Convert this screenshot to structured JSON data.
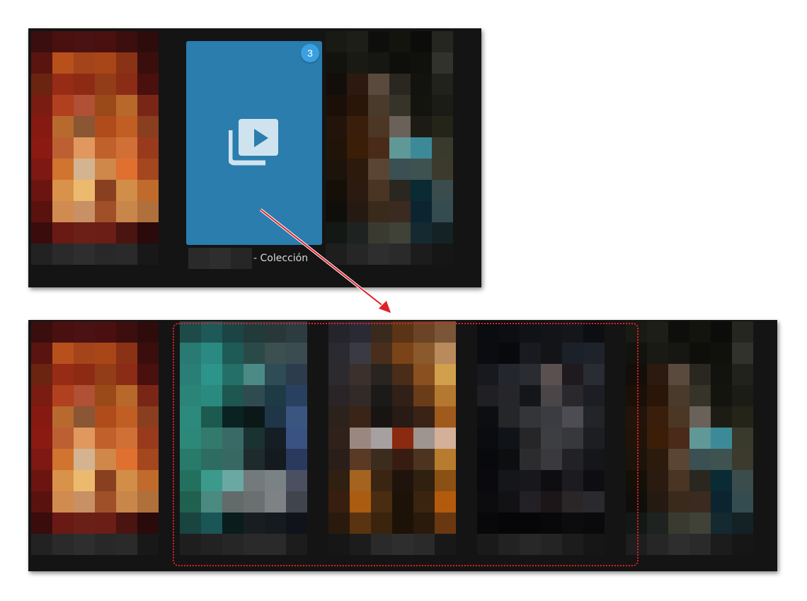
{
  "top_panel": {
    "collection_tile": {
      "badge_count": "3",
      "icon": "video-collection-icon",
      "color": "#2a7dad"
    },
    "caption_suffix": "- Colección"
  },
  "annotation": {
    "arrow_color": "#e0202a",
    "highlight_color": "#e0202a"
  }
}
